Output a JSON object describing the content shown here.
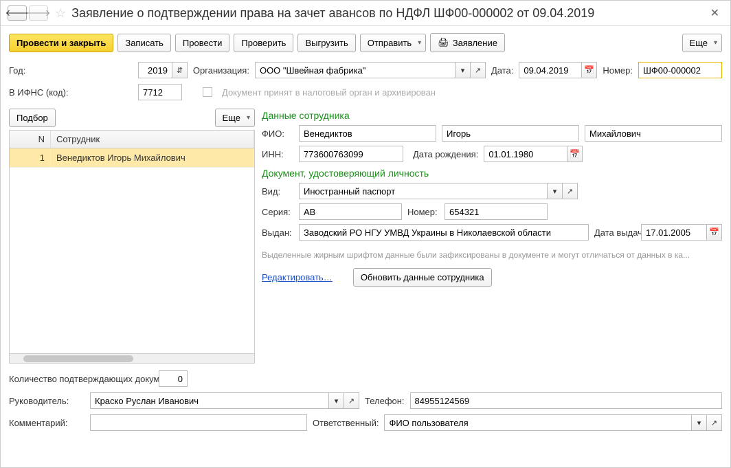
{
  "title": "Заявление о подтверждении права на зачет авансов по НДФЛ ШФ00-000002 от 09.04.2019",
  "toolbar": {
    "post_close": "Провести и закрыть",
    "save": "Записать",
    "post": "Провести",
    "check": "Проверить",
    "export": "Выгрузить",
    "send": "Отправить",
    "application": "Заявление",
    "more": "Еще"
  },
  "header": {
    "year_label": "Год:",
    "year_value": "2019",
    "org_label": "Организация:",
    "org_value": "ООО \"Швейная фабрика\"",
    "date_label": "Дата:",
    "date_value": "09.04.2019",
    "number_label": "Номер:",
    "number_value": "ШФ00-000002",
    "ifns_label": "В ИФНС (код):",
    "ifns_value": "7712",
    "archive_text": "Документ принят в налоговый орган и архивирован"
  },
  "left": {
    "pick": "Подбор",
    "more": "Еще",
    "col_n": "N",
    "col_emp": "Сотрудник",
    "rows": [
      {
        "n": "1",
        "emp": "Венедиктов Игорь Михайлович"
      }
    ]
  },
  "emp": {
    "section1": "Данные сотрудника",
    "fio_label": "ФИО:",
    "last": "Венедиктов",
    "first": "Игорь",
    "middle": "Михайлович",
    "inn_label": "ИНН:",
    "inn": "773600763099",
    "dob_label": "Дата рождения:",
    "dob": "01.01.1980",
    "section2": "Документ, удостоверяющий личность",
    "kind_label": "Вид:",
    "kind": "Иностранный паспорт",
    "series_label": "Серия:",
    "series": "AB",
    "docnum_label": "Номер:",
    "docnum": "654321",
    "issued_label": "Выдан:",
    "issued": "Заводский РО НГУ УМВД Украины в Николаевской области",
    "issue_date_label": "Дата выдачи:",
    "issue_date": "17.01.2005",
    "hint": "Выделенные жирным шрифтом данные были зафиксированы в документе и могут отличаться от данных в ка...",
    "edit_link": "Редактировать…",
    "refresh_btn": "Обновить данные сотрудника"
  },
  "footer": {
    "doc_count_label": "Количество подтверждающих документов:",
    "doc_count": "0",
    "manager_label": "Руководитель:",
    "manager": "Краско Руслан Иванович",
    "phone_label": "Телефон:",
    "phone": "84955124569",
    "comment_label": "Комментарий:",
    "comment": "",
    "responsible_label": "Ответственный:",
    "responsible": "ФИО пользователя"
  }
}
